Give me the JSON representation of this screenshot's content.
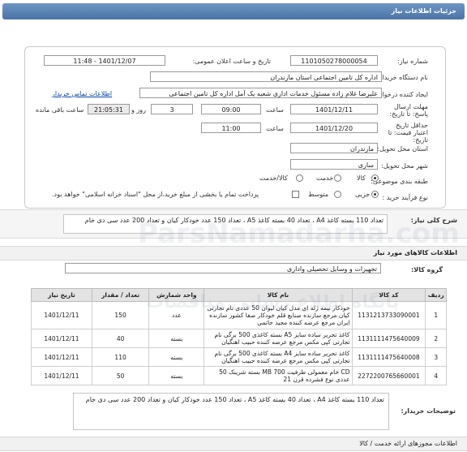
{
  "header": {
    "title": "جزئیات اطلاعات نیاز"
  },
  "fields": {
    "need_number_label": "شماره نیاز:",
    "need_number": "1101050278000054",
    "announce_label": "تاریخ و ساعت اعلان عمومی:",
    "announce_value": "1401/12/07 - 11:48",
    "buyer_label": "نام دستگاه خریدار:",
    "buyer_value": "اداره کل تامین اجتماعی استان مازندران",
    "creator_label": "ایجاد کننده درخواست:",
    "creator_value": "علیرضا غلام زاده مسئول خدمات اداری شعبه یک آمل اداره کل تامین اجتماعی",
    "contact_link": "اطلاعات تماس خریدار",
    "deadline_label": "مهلت ارسال پاسخ: تا تاریخ:",
    "deadline_date": "1401/12/11",
    "time_label": "ساعت",
    "deadline_time": "09:00",
    "days_value": "3",
    "days_label": "روز و",
    "remaining_time": "21:05:31",
    "remaining_label": "ساعت باقی مانده",
    "validity_label": "حداقل تاریخ اعتبار قیمت: تا تاریخ:",
    "validity_date": "1401/12/20",
    "validity_time": "11:00",
    "province_label": "استان محل تحویل:",
    "province_value": "مازندران",
    "city_label": "شهر محل تحویل:",
    "city_value": "ساری",
    "category_label": "طبقه بندی موضوعی:",
    "cat_goods": "کالا",
    "cat_service": "خدمت",
    "cat_goods_service": "کالا/خدمت",
    "process_label": "نوع فرآیند خرید :",
    "proc_minor": "جزیی",
    "proc_medium": "متوسط",
    "payment_text": "پرداخت تمام یا بخشی از مبلغ خرید،از محل \"اسناد خزانه اسلامی\" خواهد بود."
  },
  "summary": {
    "label": "شرح کلی نیاز:",
    "text": "تعداد 110 بسته کاغذ A4 ، تعداد 40 بسته کاغذ A5 ، تعداد 150 عدد خودکار کیان و تعداد 200 عدد سی دی خام"
  },
  "goods_section": {
    "title": "اطلاعات کالاهای مورد نیاز"
  },
  "group": {
    "label": "گروه کالا:",
    "value": "تجهیزات و وسایل تحصیلی واداری"
  },
  "table": {
    "headers": [
      "ردیف",
      "کد کالا",
      "نام کالا",
      "واحد شمارش",
      "تعداد / مقدار",
      "تاریخ نیاز"
    ],
    "rows": [
      [
        "1",
        "1131213733090001",
        "خودکار نیمه ژله ای مدل کیان لیوان 50 عددی نام تجارتی کیان مرجع سازنده صنایع قلم خودکار صفا کشور سازنده ایران مرجع عرضه کننده مجید حاتمی",
        "عدد",
        "150",
        "1401/12/11"
      ],
      [
        "2",
        "1131111475640009",
        "کاغذ تحریر ساده سایز A5 بسته کاغذی 500 برگی نام تجارتی کپی مکس مرجع عرضه کننده حبیب اهنگیان",
        "بسته",
        "40",
        "1401/12/11"
      ],
      [
        "3",
        "1131111475640008",
        "کاغذ تحریر ساده سایز A4 بسته کاغذی 500 برگی نام تجارتی کپی مکس مرجع عرضه کننده حبیب اهنگیان",
        "بسته",
        "110",
        "1401/12/11"
      ],
      [
        "4",
        "2272200765660001",
        "CD خام معمولی ظرفیت MB 700 بسته شرینک 50 عددی نوع فشرده قرن 21",
        "بسته",
        "50",
        "1401/12/11"
      ]
    ]
  },
  "notes": {
    "label": "توضیحات خریدار:",
    "text": "تعداد 110 بسته کاغذ A4 ، تعداد 40 بسته کاغذ A5 ، تعداد 150 عدد خودکار کیان و تعداد 200 عدد سی دی خام"
  },
  "footer": {
    "text": "اطلاعات مجوزهای ارائه خدمت / کالا"
  },
  "watermark": {
    "main": "ParsNamadarha.com",
    "sub": "پایگاه اطلاع رسانی مناقصات"
  }
}
